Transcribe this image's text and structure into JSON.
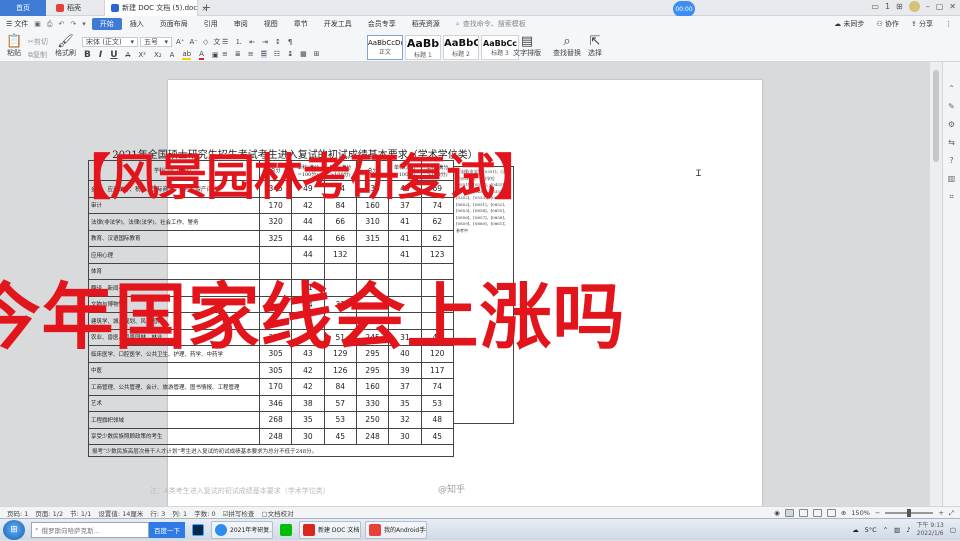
{
  "tabs": {
    "home": "首页",
    "daoke": "稻壳",
    "doc": "新建 DOC 文档 (5).doc",
    "add": "+"
  },
  "timer": "00:00",
  "tab_right": {
    "badge": "1",
    "avatar_icon": "avatar-icon"
  },
  "menu": {
    "file": "文件",
    "items": [
      "开始",
      "插入",
      "页面布局",
      "引用",
      "审阅",
      "视图",
      "章节",
      "开发工具",
      "会员专享",
      "稻壳资源"
    ],
    "active": "开始",
    "search_placeholder": "查找命令、搜索模板",
    "right": [
      "未同步",
      "协作",
      "分享"
    ]
  },
  "ribbon": {
    "paste": "粘贴",
    "cut": "剪切",
    "copy": "复制",
    "format_painter": "格式刷",
    "font_name": "宋体 (正文)",
    "font_size": "五号",
    "bold": "B",
    "italic": "I",
    "underline": "U",
    "styles": [
      {
        "preview": "AaBbCcDd",
        "label": "正文"
      },
      {
        "preview": "AaBb",
        "label": "标题 1"
      },
      {
        "preview": "AaBbC",
        "label": "标题 2"
      },
      {
        "preview": "AaBbCc",
        "label": "标题 3"
      }
    ],
    "text_layout": "文字排版",
    "find_replace": "查找替换",
    "select": "选择"
  },
  "document": {
    "table_title": "2021年全国硕士研究生招生考试考生进入复试的初试成绩基本要求（学术学位类）",
    "headers": [
      "学科门类（专业）",
      "总分",
      "单科(满分=100分)",
      "单科(满分>100分)",
      "总分",
      "单科(满分=100分)",
      "单科(满分>100分)"
    ],
    "rows": [
      {
        "subject": "金融、应用统计、税务、国际商务、保险、资产评估",
        "v": [
          "345",
          "49",
          "74",
          "335",
          "46",
          "69"
        ]
      },
      {
        "subject": "审计",
        "v": [
          "170",
          "42",
          "84",
          "160",
          "37",
          "74"
        ]
      },
      {
        "subject": "法律(非法学)、法律(法学)、社会工作、警务",
        "v": [
          "320",
          "44",
          "66",
          "310",
          "41",
          "62"
        ]
      },
      {
        "subject": "教育、汉语国际教育",
        "v": [
          "325",
          "44",
          "66",
          "315",
          "41",
          "62"
        ]
      },
      {
        "subject": "应用心理",
        "v": [
          "",
          "44",
          "132",
          "",
          "41",
          "123"
        ]
      },
      {
        "subject": "体育",
        "v": [
          "",
          "",
          "",
          "",
          "",
          ""
        ]
      },
      {
        "subject": "翻译、新闻与传播、出版",
        "v": [
          "",
          "51",
          "",
          "",
          "",
          ""
        ]
      },
      {
        "subject": "文物与博物馆",
        "v": [
          "",
          "44",
          "32",
          "",
          "",
          ""
        ]
      },
      {
        "subject": "建筑学、城乡规划、风景园林",
        "v": [
          "",
          "",
          "",
          "",
          "",
          ""
        ]
      },
      {
        "subject": "农业、兽医、风景园林、林业",
        "v": [
          "255",
          "34",
          "51",
          "245",
          "31",
          "47"
        ]
      },
      {
        "subject": "临床医学、口腔医学、公共卫生、护理、药学、中药学",
        "v": [
          "305",
          "43",
          "129",
          "295",
          "40",
          "120"
        ]
      },
      {
        "subject": "中医",
        "v": [
          "305",
          "42",
          "126",
          "295",
          "39",
          "117"
        ]
      },
      {
        "subject": "工商管理、公共管理、会计、旅游管理、图书情报、工程管理",
        "v": [
          "170",
          "42",
          "84",
          "160",
          "37",
          "74"
        ]
      },
      {
        "subject": "艺术",
        "v": [
          "346",
          "38",
          "57",
          "330",
          "35",
          "53"
        ]
      },
      {
        "subject": "工程旗帜领域",
        "v": [
          "268",
          "35",
          "53",
          "250",
          "32",
          "48"
        ]
      },
      {
        "subject": "享受少数民族照顾政策的考生",
        "v": [
          "248",
          "30",
          "45",
          "248",
          "30",
          "45"
        ]
      }
    ],
    "footer": "报考“少数民族高层次骨干人才计划”考生进入复试的初试成绩基本要求为总分不低于248分。",
    "side_notes": "※法律(非法学)[0351]、(法学)[0351]；专业学位[0551]、[0552]、[0451]、[0453]、[0454]、[0351]、[0352]、[0553]、[0651]、[0652]、[0851]、[0852]、[0853]、[0854]、[0855]、[0856]、[0857]、[0858]、[0859]、[0860]、[0861]；参考中",
    "faint_line": "注：A类考生进入复试的初试成绩基本要求（学术学位类）",
    "watermark": "@知乎"
  },
  "overlay": {
    "line1": "【风景园林考研复试】",
    "line2": "今年国家线会上涨吗",
    "color": "#e3151c"
  },
  "statusbar": {
    "page": "页码: 1",
    "pages": "页面: 1/2",
    "section": "节: 1/1",
    "setting": "设置值: 14厘米",
    "row": "行: 3",
    "col": "列: 1",
    "words": "字数: 0",
    "spell": "拼写检查",
    "proof": "文档校对",
    "zoom": "150%"
  },
  "taskbar": {
    "search_placeholder": "俄罗斯向哈萨克斯...",
    "search_button": "百度一下",
    "apps": [
      "2021年考研复...",
      "新建 DOC 文档 (...",
      "我的Android手机"
    ],
    "temperature": "5°C",
    "time": "下午 9:13",
    "date": "2022/1/6"
  }
}
